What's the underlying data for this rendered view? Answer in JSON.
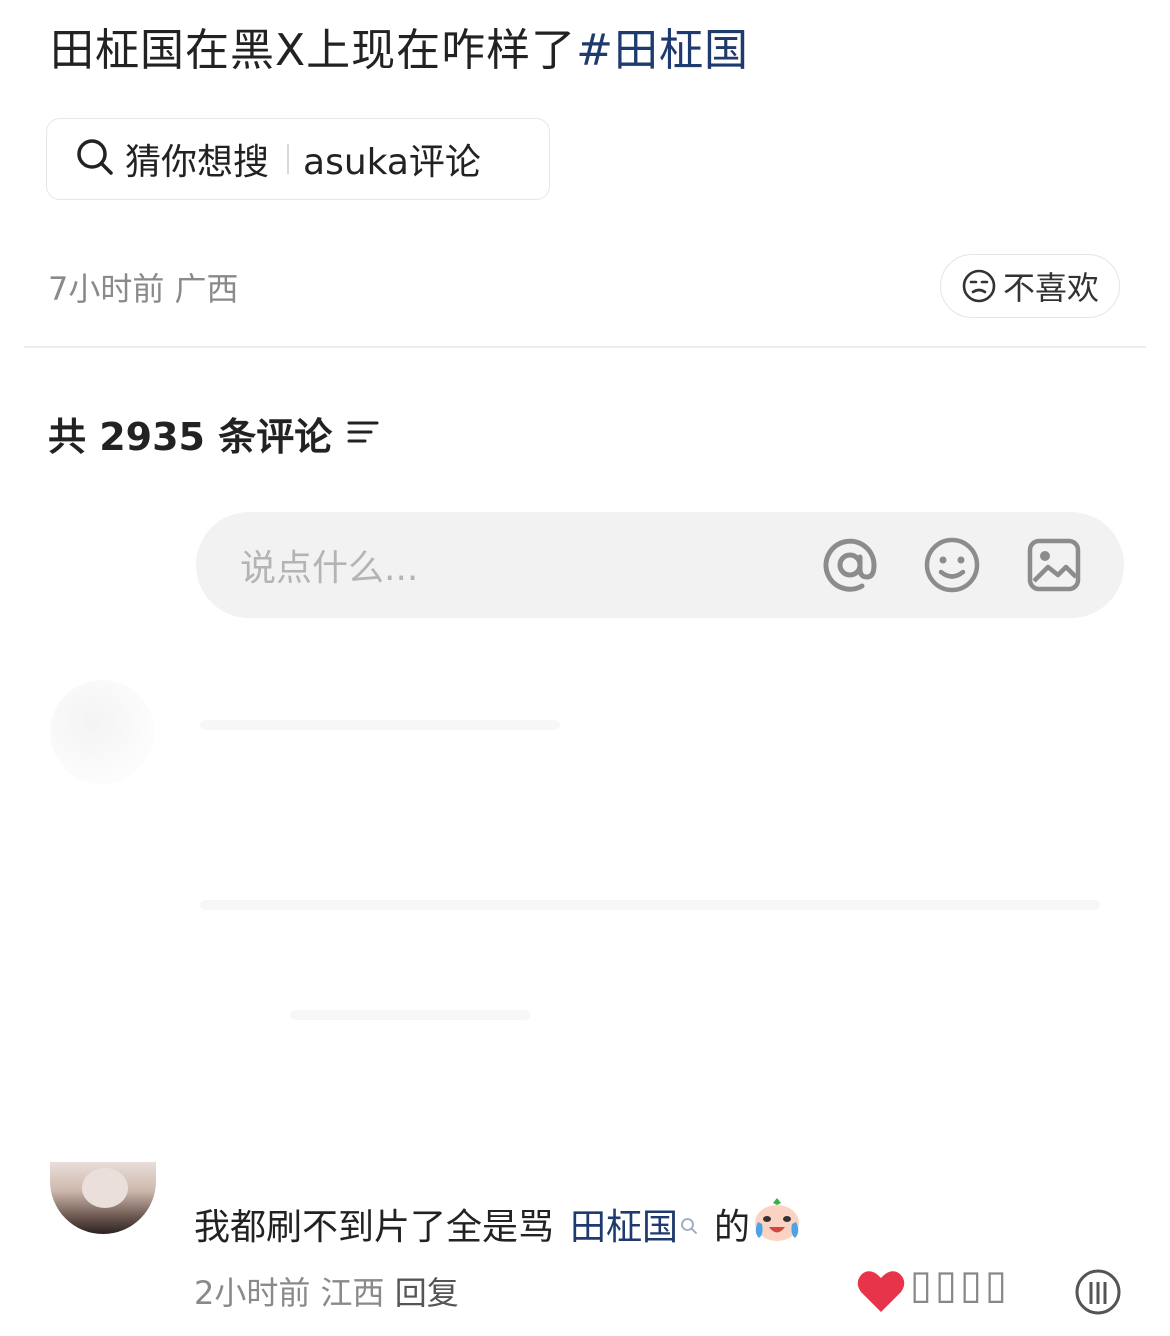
{
  "post": {
    "title_text": "田柾国在黑X上现在咋样了",
    "title_tag": "#田柾国"
  },
  "search_chip": {
    "label": "猜你想搜",
    "keyword": "asuka评论"
  },
  "meta": {
    "time_location": "7小时前 广西"
  },
  "dislike_button": {
    "label": "不喜欢"
  },
  "comments_header": {
    "count_text": "共 2935 条评论"
  },
  "composer": {
    "placeholder": "说点什么..."
  },
  "comment": {
    "text": "我都刷不到片了全是骂",
    "topic": "田柾国",
    "suffix": "的",
    "time": "2小时前",
    "location": "江西",
    "reply_label": "回复"
  },
  "colors": {
    "topic": "#1f3a6e",
    "heart": "#e8344b",
    "meta": "#8a8a8a"
  }
}
